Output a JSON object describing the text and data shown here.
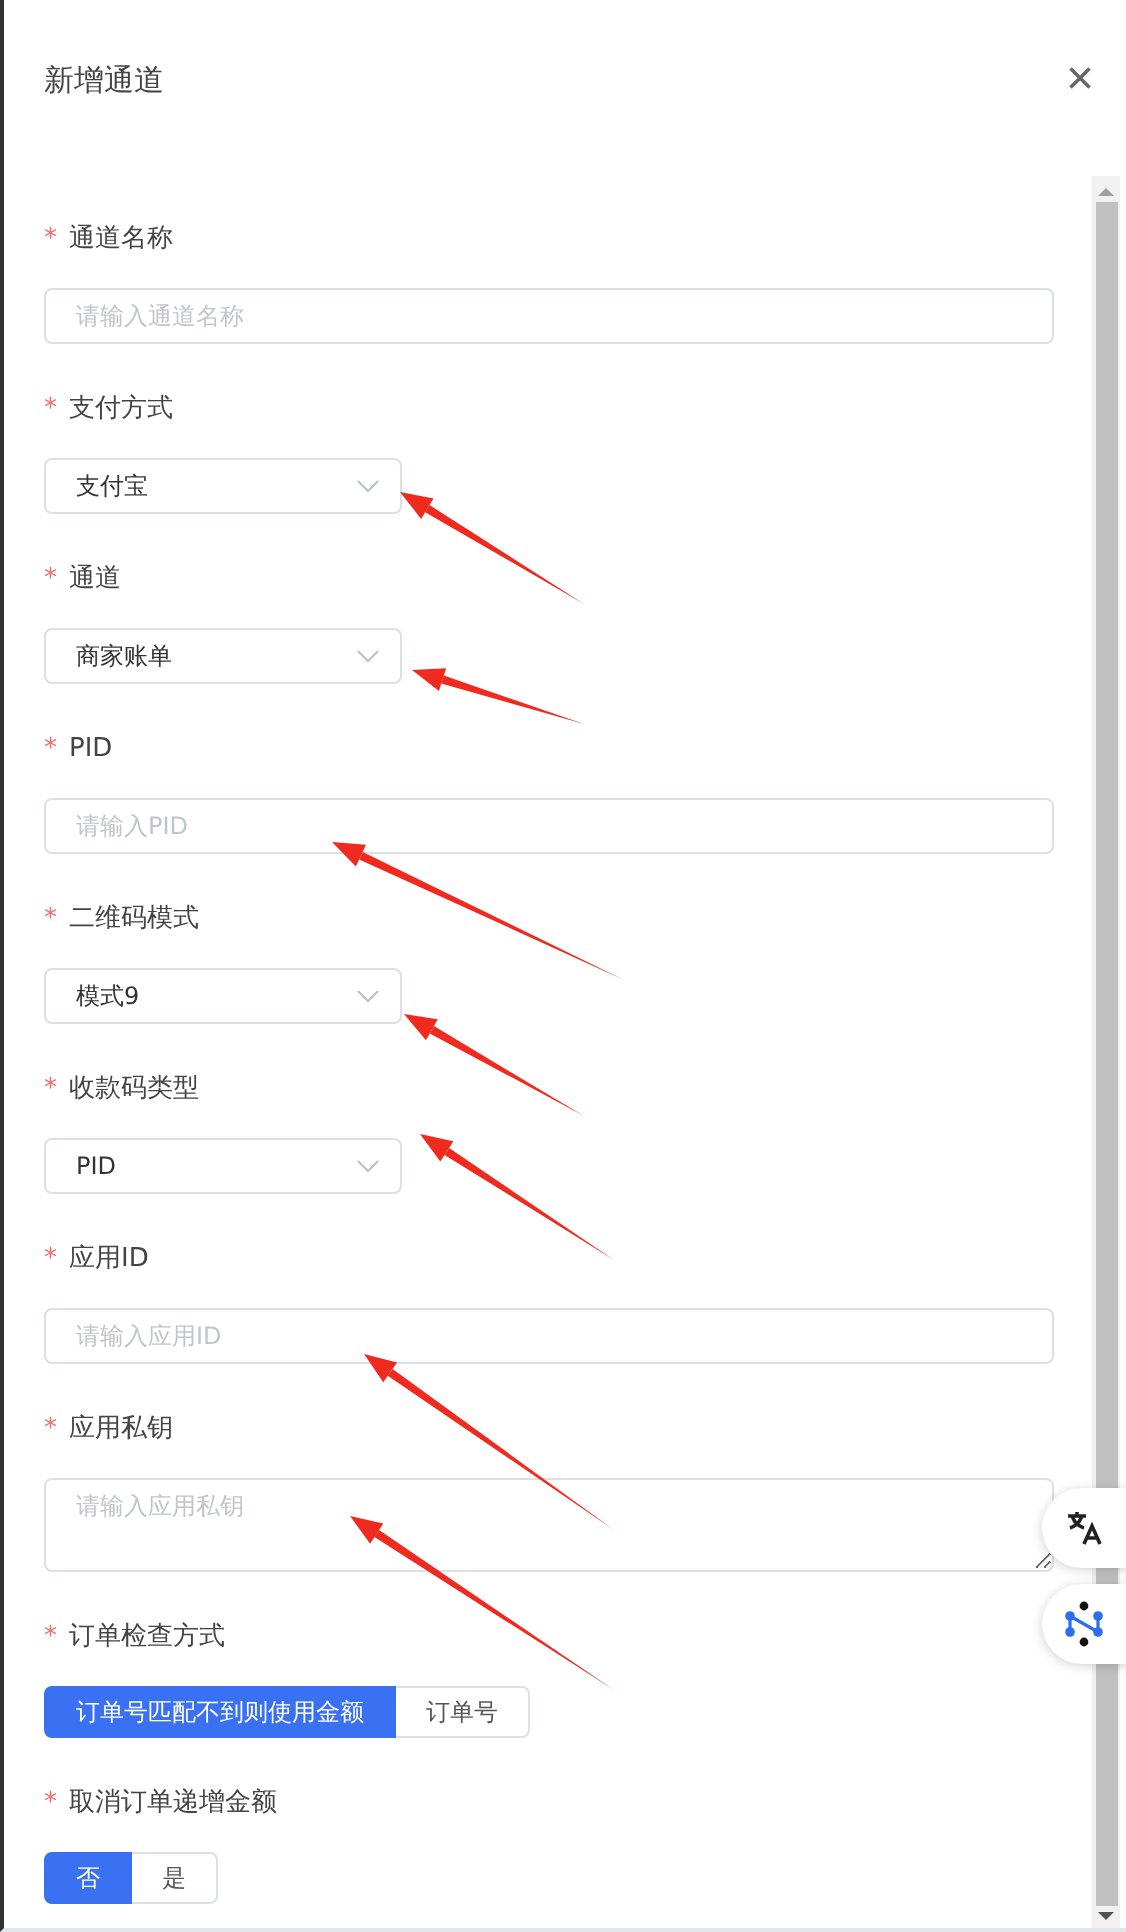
{
  "dialog": {
    "title": "新增通道",
    "close": "×"
  },
  "fields": [
    {
      "kind": "input",
      "label": "通道名称",
      "required_mark": "*",
      "placeholder": "请输入通道名称"
    },
    {
      "kind": "select",
      "label": "支付方式",
      "required_mark": "*",
      "value": "支付宝"
    },
    {
      "kind": "select",
      "label": "通道",
      "required_mark": "*",
      "value": "商家账单"
    },
    {
      "kind": "input",
      "label": "PID",
      "required_mark": "*",
      "placeholder": "请输入PID"
    },
    {
      "kind": "select",
      "label": "二维码模式",
      "required_mark": "*",
      "value": "模式9"
    },
    {
      "kind": "select",
      "label": "收款码类型",
      "required_mark": "*",
      "value": "PID"
    },
    {
      "kind": "input",
      "label": "应用ID",
      "required_mark": "*",
      "placeholder": "请输入应用ID"
    },
    {
      "kind": "textarea",
      "label": "应用私钥",
      "required_mark": "*",
      "placeholder": "请输入应用私钥"
    },
    {
      "kind": "segmented",
      "label": "订单检查方式",
      "required_mark": "*",
      "options": [
        {
          "label": "订单号匹配不到则使用金额",
          "selected": true
        },
        {
          "label": "订单号",
          "selected": false
        }
      ]
    },
    {
      "kind": "segmented",
      "label": "取消订单递增金额",
      "required_mark": "*",
      "options": [
        {
          "label": "否",
          "selected": true
        },
        {
          "label": "是",
          "selected": false
        }
      ]
    }
  ]
}
